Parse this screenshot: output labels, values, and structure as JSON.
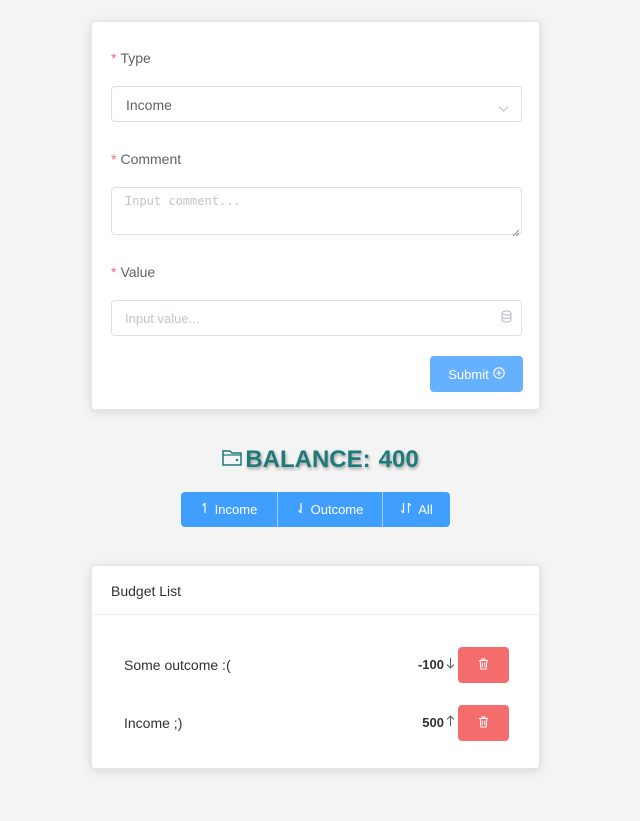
{
  "form": {
    "type_label": "Type",
    "type_value": "Income",
    "comment_label": "Comment",
    "comment_placeholder": "Input comment...",
    "value_label": "Value",
    "value_placeholder": "Input value...",
    "required_marker": "*",
    "submit_label": "Submit"
  },
  "balance": {
    "label": "BALANCE:",
    "value": "400"
  },
  "filters": {
    "income": "Income",
    "outcome": "Outcome",
    "all": "All"
  },
  "budget_list": {
    "title": "Budget List",
    "items": [
      {
        "comment": "Some outcome :(",
        "value": "-100",
        "direction": "down"
      },
      {
        "comment": "Income ;)",
        "value": "500",
        "direction": "up"
      }
    ]
  },
  "colors": {
    "primary": "#409eff",
    "submit": "#66b1ff",
    "danger": "#f56c6c",
    "balance_text": "#1f7a7a",
    "background": "#f4f4f4"
  },
  "icons": {
    "select_arrow": "chevron-down-icon",
    "value_suffix": "coins-icon",
    "submit": "circle-plus-icon",
    "balance": "wallet-icon",
    "delete": "trash-icon"
  }
}
